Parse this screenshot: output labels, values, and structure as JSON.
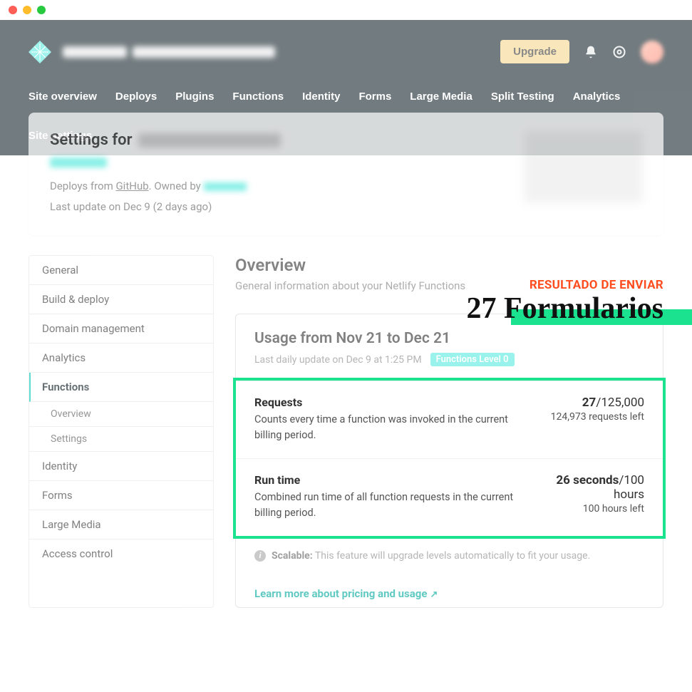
{
  "header": {
    "upgrade_label": "Upgrade"
  },
  "nav": {
    "items": [
      "Site overview",
      "Deploys",
      "Plugins",
      "Functions",
      "Identity",
      "Forms",
      "Large Media",
      "Split Testing",
      "Analytics",
      "Site settings"
    ],
    "active": "Site settings"
  },
  "settings_card": {
    "title_prefix": "Settings for",
    "deploys_from": "Deploys from ",
    "github": "GitHub",
    "owned_by": ". Owned by ",
    "last_update": "Last update on Dec 9 (2 days ago)"
  },
  "annotation": {
    "label": "RESULTADO DE ENVIAR",
    "big": "27 Formularios"
  },
  "sidebar": {
    "items": [
      {
        "label": "General"
      },
      {
        "label": "Build & deploy"
      },
      {
        "label": "Domain management"
      },
      {
        "label": "Analytics"
      },
      {
        "label": "Functions",
        "active": true,
        "children": [
          "Overview",
          "Settings"
        ]
      },
      {
        "label": "Identity"
      },
      {
        "label": "Forms"
      },
      {
        "label": "Large Media"
      },
      {
        "label": "Access control"
      }
    ]
  },
  "content": {
    "title": "Overview",
    "subtitle": "General information about your Netlify Functions"
  },
  "usage": {
    "title": "Usage from Nov 21 to Dec 21",
    "meta_text": "Last daily update on Dec 9 at 1:25 PM",
    "badge": "Functions Level 0",
    "requests": {
      "title": "Requests",
      "desc": "Counts every time a function was invoked in the current billing period.",
      "value": "27",
      "limit": "/125,000",
      "remaining": "124,973 requests left"
    },
    "runtime": {
      "title": "Run time",
      "desc": "Combined run time of all function requests in the current billing period.",
      "value": "26 seconds",
      "limit": "/100 hours",
      "remaining": "100 hours left"
    },
    "scalable_label": "Scalable:",
    "scalable_text": " This feature will upgrade levels automatically to fit your usage.",
    "learn_more": "Learn more about pricing and usage"
  }
}
